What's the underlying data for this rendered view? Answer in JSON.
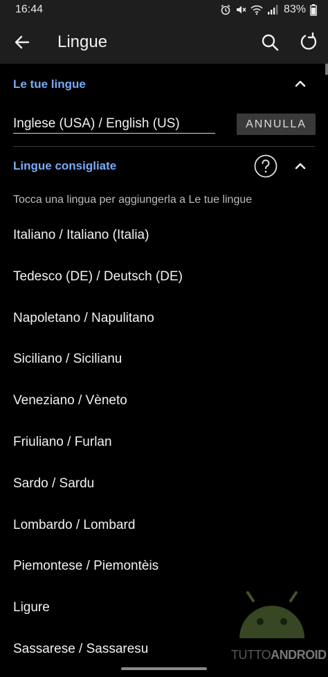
{
  "status_bar": {
    "time": "16:44",
    "battery": "83%",
    "icons": [
      "alarm-icon",
      "mute-icon",
      "wifi-icon",
      "signal-icon",
      "battery-icon"
    ]
  },
  "app_bar": {
    "title": "Lingue",
    "back_icon": "back-arrow-icon",
    "search_icon": "search-icon",
    "refresh_icon": "refresh-icon"
  },
  "your_languages": {
    "title": "Le tue lingue",
    "current_language": "Inglese (USA) / English (US)",
    "cancel_label": "ANNULLA"
  },
  "suggested": {
    "title": "Lingue consigliate",
    "hint": "Tocca una lingua per aggiungerla a Le tue lingue",
    "items": [
      "Italiano / Italiano (Italia)",
      "Tedesco (DE) / Deutsch (DE)",
      "Napoletano / Napulitano",
      "Siciliano / Sicilianu",
      "Veneziano / Vèneto",
      "Friuliano / Furlan",
      "Sardo / Sardu",
      "Lombardo / Lombard",
      "Piemontese / Piemontèis",
      "Ligure",
      "Sassarese / Sassaresu"
    ]
  },
  "watermark": {
    "part1": "TUTTO",
    "part2": "ANDROID"
  },
  "colors": {
    "accent": "#7baaf7",
    "background": "#000000",
    "bar": "#1e1e1e"
  }
}
